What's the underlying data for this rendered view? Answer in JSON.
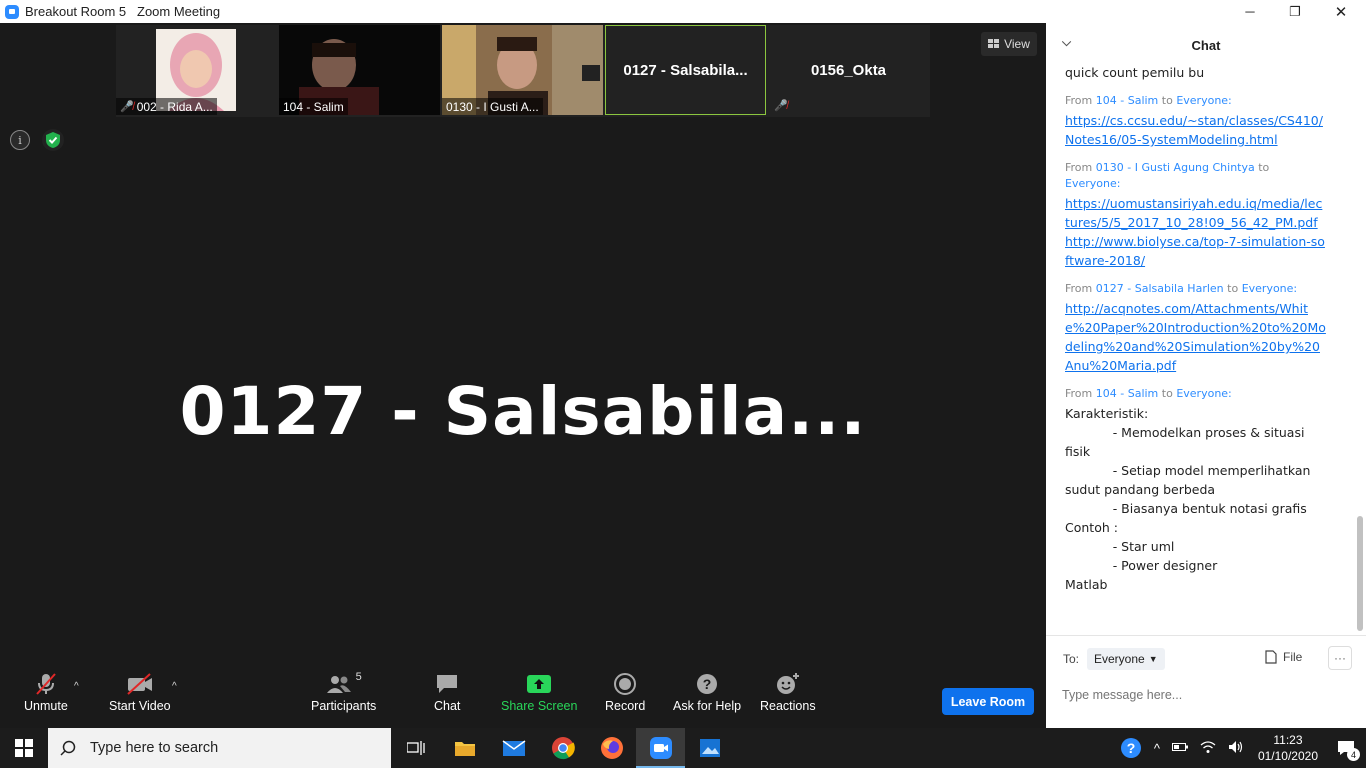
{
  "window": {
    "title": "Breakout Room 5   Zoom Meeting",
    "minimize": "─",
    "restore": "❐",
    "close": "✕"
  },
  "strip": {
    "tiles": [
      {
        "name": "002 - Rida A...",
        "muted": true,
        "kind": "video"
      },
      {
        "name": "104 - Salim",
        "muted": false,
        "kind": "video"
      },
      {
        "name": "0130 - I Gusti A...",
        "muted": false,
        "kind": "video"
      },
      {
        "name": "0127 - Salsabila...",
        "muted": false,
        "kind": "name",
        "active": true
      },
      {
        "name": "0156_Okta",
        "muted": true,
        "kind": "name"
      }
    ]
  },
  "view_button": "View",
  "active_speaker": "0127  -  Salsabila...",
  "toolbar": {
    "unmute": "Unmute",
    "start_video": "Start Video",
    "participants": "Participants",
    "participants_count": "5",
    "chat": "Chat",
    "share_screen": "Share Screen",
    "record": "Record",
    "ask_for_help": "Ask for Help",
    "reactions": "Reactions",
    "leave_room": "Leave Room"
  },
  "chat": {
    "title": "Chat",
    "messages": [
      {
        "text": "quick count pemilu bu"
      },
      {
        "from": "104 - Salim",
        "to": "Everyone:",
        "links": [
          "https://cs.ccsu.edu/~stan/classes/CS410/Notes16/05-SystemModeling.html"
        ]
      },
      {
        "from": "0130 - I Gusti Agung Chintya",
        "to": "Everyone:",
        "links": [
          "https://uomustansiriyah.edu.iq/media/lectures/5/5_2017_10_28!09_56_42_PM.pdf",
          "http://www.biolyse.ca/top-7-simulation-software-2018/"
        ]
      },
      {
        "from": "0127 - Salsabila Harlen",
        "to": "Everyone:",
        "links": [
          "http://acqnotes.com/Attachments/White%20Paper%20Introduction%20to%20Modeling%20and%20Simulation%20by%20Anu%20Maria.pdf"
        ]
      },
      {
        "from": "104 - Salim",
        "to": "Everyone:",
        "text": "Karakteristik:\n            - Memodelkan proses & situasi fisik\n            - Setiap model memperlihatkan sudut pandang berbeda\n            - Biasanya bentuk notasi grafis\nContoh :\n            - Star uml\n            - Power designer\nMatlab"
      }
    ],
    "from_word": "From",
    "to_word": "to",
    "to_label": "To:",
    "recipient": "Everyone",
    "file_label": "File",
    "more": "···",
    "input_placeholder": "Type message here..."
  },
  "taskbar": {
    "search_placeholder": "Type here to search",
    "time": "11:23",
    "date": "01/10/2020",
    "notification_count": "4"
  }
}
